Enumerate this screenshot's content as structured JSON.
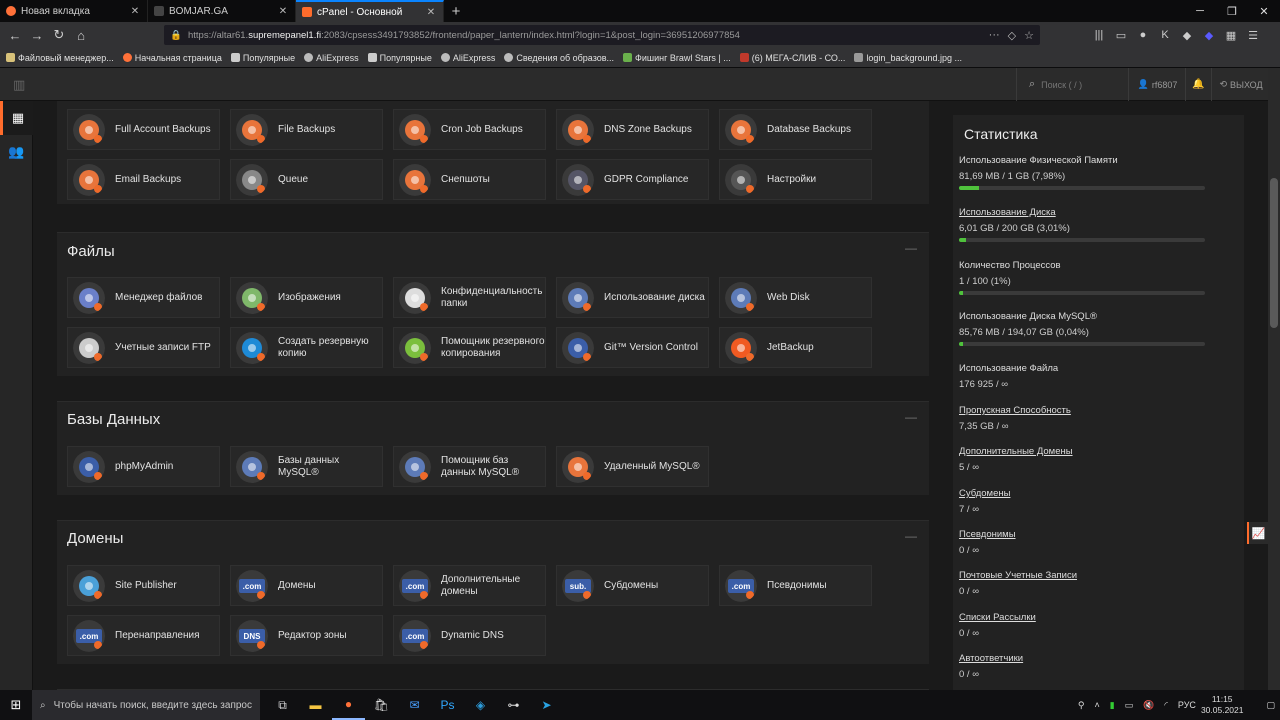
{
  "browser": {
    "tabs": [
      {
        "title": "Новая вкладка",
        "color": "#ff7139"
      },
      {
        "title": "BOMJAR.GA",
        "color": "#555"
      },
      {
        "title": "cPanel - Основной",
        "color": "#ff6c2c"
      }
    ],
    "url_prefix": "https://altar61.",
    "url_host": "supremepanel1.fi",
    "url_rest": ":2083/cpsess3491793852/frontend/paper_lantern/index.html?login=1&post_login=36951206977854",
    "bookmarks": [
      "Файловый менеджер...",
      "Начальная страница",
      "Популярные",
      "AliExpress",
      "Популярные",
      "AliExpress",
      "Сведения об образов...",
      "Фишинг Brawl Stars | ...",
      "(6) МЕГА-СЛИВ - СО...",
      "login_background.jpg ..."
    ]
  },
  "header": {
    "search_placeholder": "Поиск ( / )",
    "user": "rf6807",
    "logout": "ВЫХОД"
  },
  "sections": {
    "backup_items": [
      {
        "label": "Full Account Backups",
        "color": "#e8743b",
        "icon": "person-icon"
      },
      {
        "label": "File Backups",
        "color": "#e8743b",
        "icon": "file-icon"
      },
      {
        "label": "Cron Job Backups",
        "color": "#e8743b",
        "icon": "clock-icon"
      },
      {
        "label": "DNS Zone Backups",
        "color": "#e8743b",
        "icon": "pin-icon"
      },
      {
        "label": "Database Backups",
        "color": "#e8743b",
        "icon": "database-icon"
      },
      {
        "label": "Email Backups",
        "color": "#e8743b",
        "icon": "mail-icon"
      },
      {
        "label": "Queue",
        "color": "#888",
        "icon": "people-icon"
      },
      {
        "label": "Снепшоты",
        "color": "#e8743b",
        "icon": "camera-icon"
      },
      {
        "label": "GDPR Compliance",
        "color": "#556",
        "icon": "gdpr-icon"
      },
      {
        "label": "Настройки",
        "color": "#555",
        "icon": "gear-icon"
      }
    ],
    "files": {
      "title": "Файлы",
      "items": [
        {
          "label": "Менеджер файлов",
          "color": "#6a7fc9",
          "icon": "file-manager-icon"
        },
        {
          "label": "Изображения",
          "color": "#7fb86a",
          "icon": "image-icon"
        },
        {
          "label": "Конфиденциальность папки",
          "color": "#ddd",
          "icon": "folder-lock-icon"
        },
        {
          "label": "Использование диска",
          "color": "#5d7bb8",
          "icon": "disk-icon"
        },
        {
          "label": "Web Disk",
          "color": "#5d7bb8",
          "icon": "webdisk-icon"
        },
        {
          "label": "Учетные записи FTP",
          "color": "#ccc",
          "icon": "truck-icon"
        },
        {
          "label": "Создать резервную копию",
          "color": "#1e8ad6",
          "icon": "backup-icon"
        },
        {
          "label": "Помощник резервного копирования",
          "color": "#7bbf3d",
          "icon": "backup-wizard-icon"
        },
        {
          "label": "Git™ Version Control",
          "color": "#3b5ea8",
          "icon": "git-icon"
        },
        {
          "label": "JetBackup",
          "color": "#f05a22",
          "icon": "jetbackup-icon"
        }
      ]
    },
    "databases": {
      "title": "Базы Данных",
      "items": [
        {
          "label": "phpMyAdmin",
          "color": "#3b5ea8",
          "icon": "phpmyadmin-icon"
        },
        {
          "label": "Базы данных MySQL®",
          "color": "#5d7bb8",
          "icon": "database-icon"
        },
        {
          "label": "Помощник баз данных MySQL®",
          "color": "#5d7bb8",
          "icon": "database-wizard-icon"
        },
        {
          "label": "Удаленный MySQL®",
          "color": "#e8743b",
          "icon": "remote-database-icon"
        }
      ]
    },
    "domains": {
      "title": "Домены",
      "items": [
        {
          "label": "Site Publisher",
          "color": "#4aa0d8",
          "icon": "paper-plane-icon",
          "tag": ""
        },
        {
          "label": "Домены",
          "color": "#3b5ea8",
          "icon": "domain-icon",
          "tag": ".com"
        },
        {
          "label": "Дополнительные домены",
          "color": "#3b5ea8",
          "icon": "addon-domain-icon",
          "tag": ".com"
        },
        {
          "label": "Субдомены",
          "color": "#3b5ea8",
          "icon": "subdomain-icon",
          "tag": "sub."
        },
        {
          "label": "Псевдонимы",
          "color": "#3b5ea8",
          "icon": "alias-icon",
          "tag": ".com"
        },
        {
          "label": "Перенаправления",
          "color": "#3b5ea8",
          "icon": "redirect-icon",
          "tag": ".com"
        },
        {
          "label": "Редактор зоны",
          "color": "#3b5ea8",
          "icon": "dns-icon",
          "tag": "DNS"
        },
        {
          "label": "Dynamic DNS",
          "color": "#3b5ea8",
          "icon": "dynamic-dns-icon",
          "tag": ".com"
        }
      ]
    }
  },
  "stats": {
    "title": "Статистика",
    "items": [
      {
        "key": "Использование Физической Памяти",
        "value": "81,69 MB / 1 GB   (7,98%)",
        "link": false,
        "bar": 0.0798
      },
      {
        "key": "Использование Диска",
        "value": "6,01 GB / 200 GB   (3,01%)",
        "link": true,
        "bar": 0.0301
      },
      {
        "key": "Количество Процессов",
        "value": "1 / 100   (1%)",
        "link": false,
        "bar": 0.01
      },
      {
        "key": "Использование Диска MySQL®",
        "value": "85,76 MB / 194,07 GB   (0,04%)",
        "link": false,
        "bar": 0.0004
      },
      {
        "key": "Использование Файла",
        "value": "176 925 / ∞",
        "link": false
      },
      {
        "key": "Пропускная Способность",
        "value": "7,35 GB / ∞",
        "link": true
      },
      {
        "key": "Дополнительные Домены",
        "value": "5 / ∞",
        "link": true
      },
      {
        "key": "Субдомены",
        "value": "7 / ∞",
        "link": true
      },
      {
        "key": "Псевдонимы",
        "value": "0 / ∞",
        "link": true
      },
      {
        "key": "Почтовые Учетные Записи",
        "value": "0 / ∞",
        "link": true
      },
      {
        "key": "Списки Рассылки",
        "value": "0 / ∞",
        "link": true
      },
      {
        "key": "Автоответчики",
        "value": "0 / ∞",
        "link": true
      }
    ]
  },
  "taskbar": {
    "search_text": "Чтобы начать поиск, введите здесь запрос",
    "lang": "РУС",
    "time": "11:15",
    "date": "30.05.2021"
  }
}
